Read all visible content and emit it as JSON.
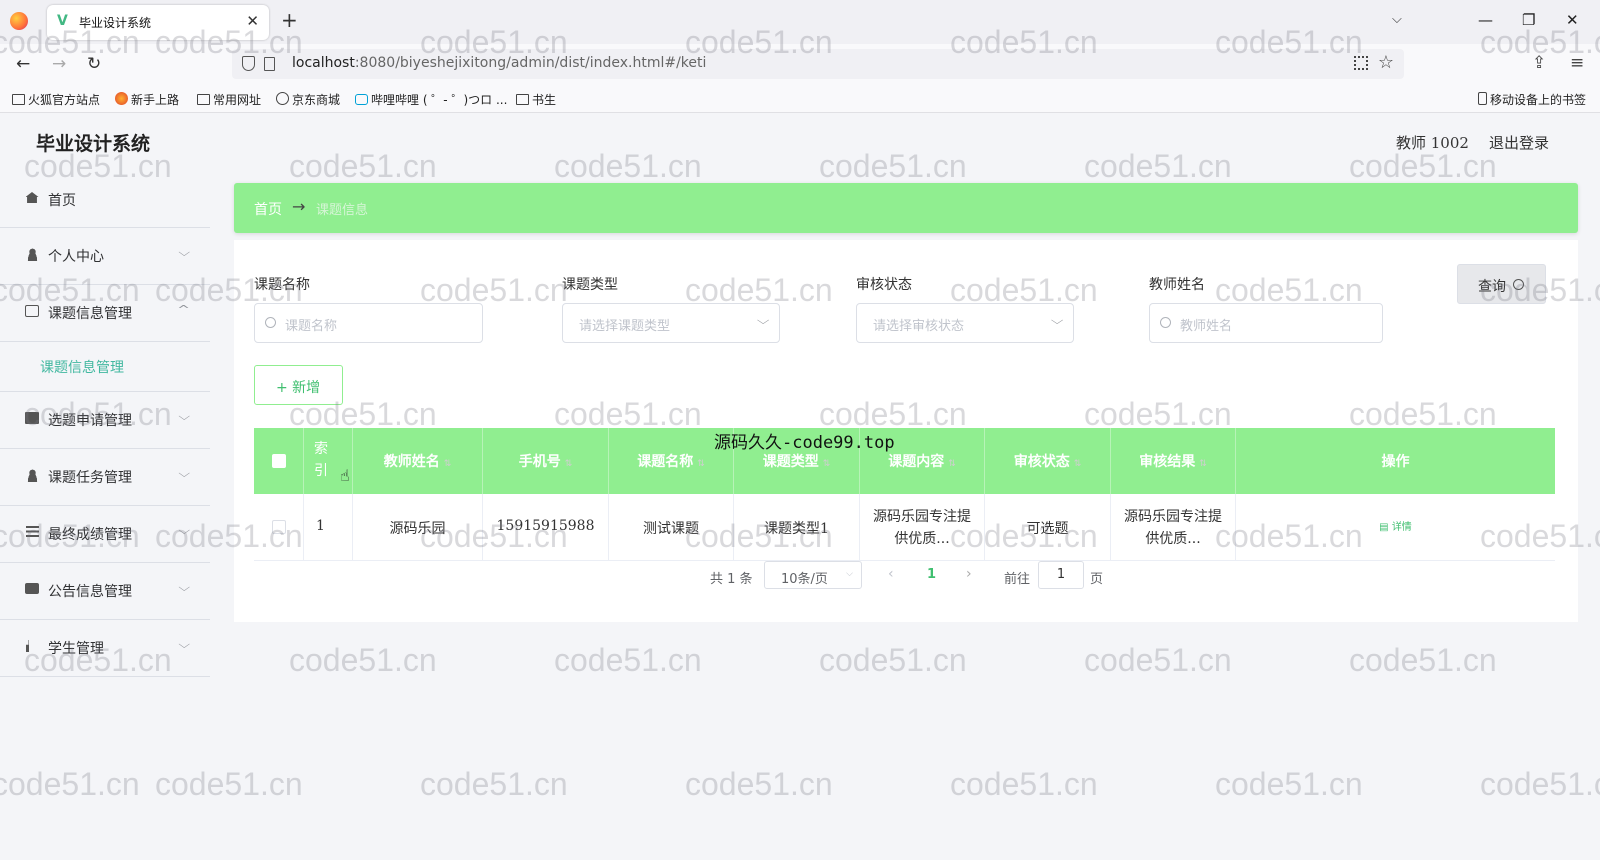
{
  "browser": {
    "tab_title": "毕业设计系统",
    "close_glyph": "✕",
    "new_tab_glyph": "+",
    "url_host": "localhost",
    "url_rest": ":8080/biyeshejixitong/admin/dist/index.html#/keti",
    "bookmarks": [
      "火狐官方站点",
      "新手上路",
      "常用网址",
      "京东商城",
      "哔哩哔哩 ( ゜- ゜)つロ ...",
      "书生"
    ],
    "mobile_bookmarks": "移动设备上的书签"
  },
  "app": {
    "title": "毕业设计系统",
    "user": "教师 1002",
    "logout": "退出登录"
  },
  "sidebar": {
    "items": [
      {
        "label": "首页",
        "icon": "home-icon"
      },
      {
        "label": "个人中心",
        "icon": "user-icon"
      },
      {
        "label": "课题信息管理",
        "icon": "chat-icon"
      },
      {
        "label": "课题信息管理"
      },
      {
        "label": "选题申请管理",
        "icon": "book-icon"
      },
      {
        "label": "课题任务管理",
        "icon": "user-icon"
      },
      {
        "label": "最终成绩管理",
        "icon": "list-icon"
      },
      {
        "label": "公告信息管理",
        "icon": "ad-icon"
      },
      {
        "label": "学生管理",
        "icon": "bar-chart-icon"
      }
    ]
  },
  "breadcrumb": {
    "home": "首页",
    "separator": "→",
    "current": "课题信息"
  },
  "filters": {
    "topic_name": {
      "label": "课题名称",
      "placeholder": "课题名称"
    },
    "topic_type": {
      "label": "课题类型",
      "placeholder": "请选择课题类型"
    },
    "review_status": {
      "label": "审核状态",
      "placeholder": "请选择审核状态"
    },
    "teacher_name": {
      "label": "教师姓名",
      "placeholder": "教师姓名"
    },
    "query_label": "查询",
    "add_label": "+ 新增"
  },
  "table": {
    "headers": [
      "索引",
      "教师姓名",
      "手机号",
      "课题名称",
      "课题类型",
      "课题内容",
      "审核状态",
      "审核结果",
      "操作"
    ],
    "sort_glyph": "⇅",
    "rows": [
      {
        "index": "1",
        "teacher": "源码乐园",
        "phone": "15915915988",
        "topic": "测试课题",
        "type": "课题类型1",
        "content": "源码乐园专注提供优质...",
        "status": "可选题",
        "result": "源码乐园专注提供优质...",
        "action": "详情"
      }
    ]
  },
  "pagination": {
    "total": "共 1 条",
    "page_size": "10条/页",
    "current": "1",
    "goto_label": "前往",
    "goto_value": "1",
    "goto_unit": "页"
  },
  "overlay_text": "源码久久-code99.top",
  "watermark": "code51.cn",
  "colors": {
    "accent": "#90ee90",
    "link": "#42b8a0"
  }
}
